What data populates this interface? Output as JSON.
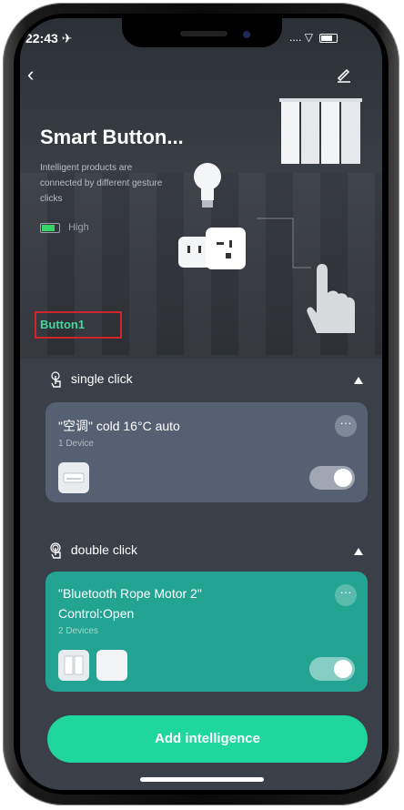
{
  "status": {
    "time": "22:43 ✈",
    "signal": "....",
    "wifi": "wifi",
    "battery": "battery"
  },
  "header": {
    "back_icon": "back-chevron-icon",
    "edit_icon": "edit-icon"
  },
  "device": {
    "title": "Smart Button...",
    "subtitle": "Intelligent products are connected by different gesture clicks",
    "battery_label": "High",
    "battery_level": 0.8,
    "button_label": "Button1"
  },
  "sections": {
    "single": {
      "label": "single click",
      "card": {
        "title": "\"空调\" cold 16°C auto",
        "devices": "1 Device",
        "enabled": true
      }
    },
    "double": {
      "label": "double click",
      "card": {
        "title_line1": "\"Bluetooth Rope Motor 2\"",
        "title_line2": "Control:Open",
        "devices": "2 Devices",
        "enabled": true
      }
    }
  },
  "cta": {
    "label": "Add intelligence"
  },
  "colors": {
    "accent": "#1fd79c",
    "card_single": "#556073",
    "card_double": "#23a492",
    "button_label": "#43d79a",
    "highlight": "#d0262b"
  },
  "more_glyph": "···"
}
